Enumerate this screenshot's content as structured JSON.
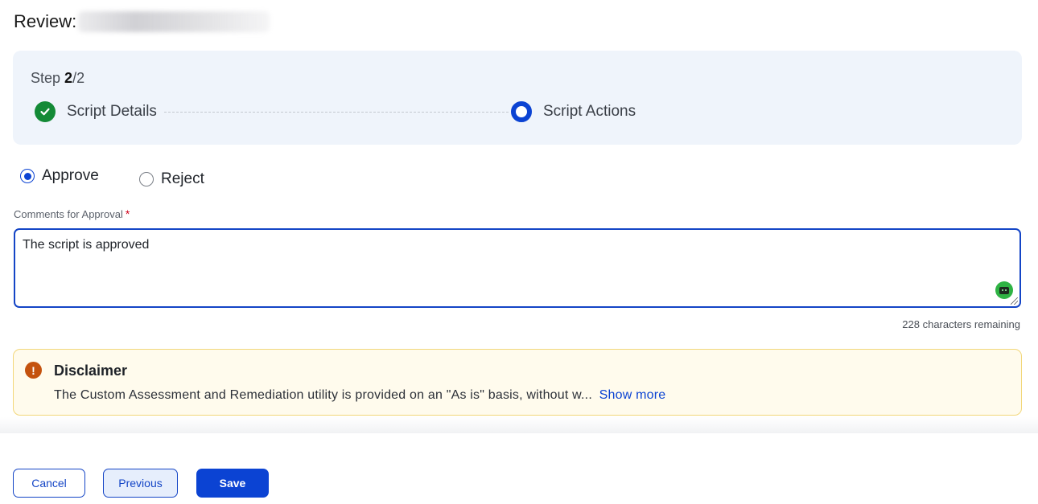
{
  "header": {
    "title_prefix": "Review:"
  },
  "stepper": {
    "step_word": "Step",
    "current_step": "2",
    "total_steps": "/2",
    "steps": [
      {
        "label": "Script Details",
        "status": "completed",
        "icon": "check-circle-icon"
      },
      {
        "label": "Script Actions",
        "status": "active",
        "icon": "active-step-icon"
      }
    ]
  },
  "decision": {
    "options": [
      {
        "label": "Approve",
        "selected": true
      },
      {
        "label": "Reject",
        "selected": false
      }
    ]
  },
  "comments": {
    "label": "Comments for Approval",
    "required_marker": "*",
    "value": "The script is approved",
    "chars_remaining": "228 characters remaining",
    "assistant_icon": "bot-icon"
  },
  "disclaimer": {
    "title": "Disclaimer",
    "text": "The Custom Assessment and Remediation utility is provided on an \"As is\" basis, without w...",
    "show_more": "Show more",
    "icon": "warning-icon"
  },
  "footer": {
    "cancel_label": "Cancel",
    "previous_label": "Previous",
    "save_label": "Save"
  },
  "colors": {
    "primary": "#0b43d3",
    "success": "#138a36",
    "warning": "#c4520e",
    "stepper_bg": "#eff4fb",
    "disclaimer_bg": "#fffbed"
  }
}
